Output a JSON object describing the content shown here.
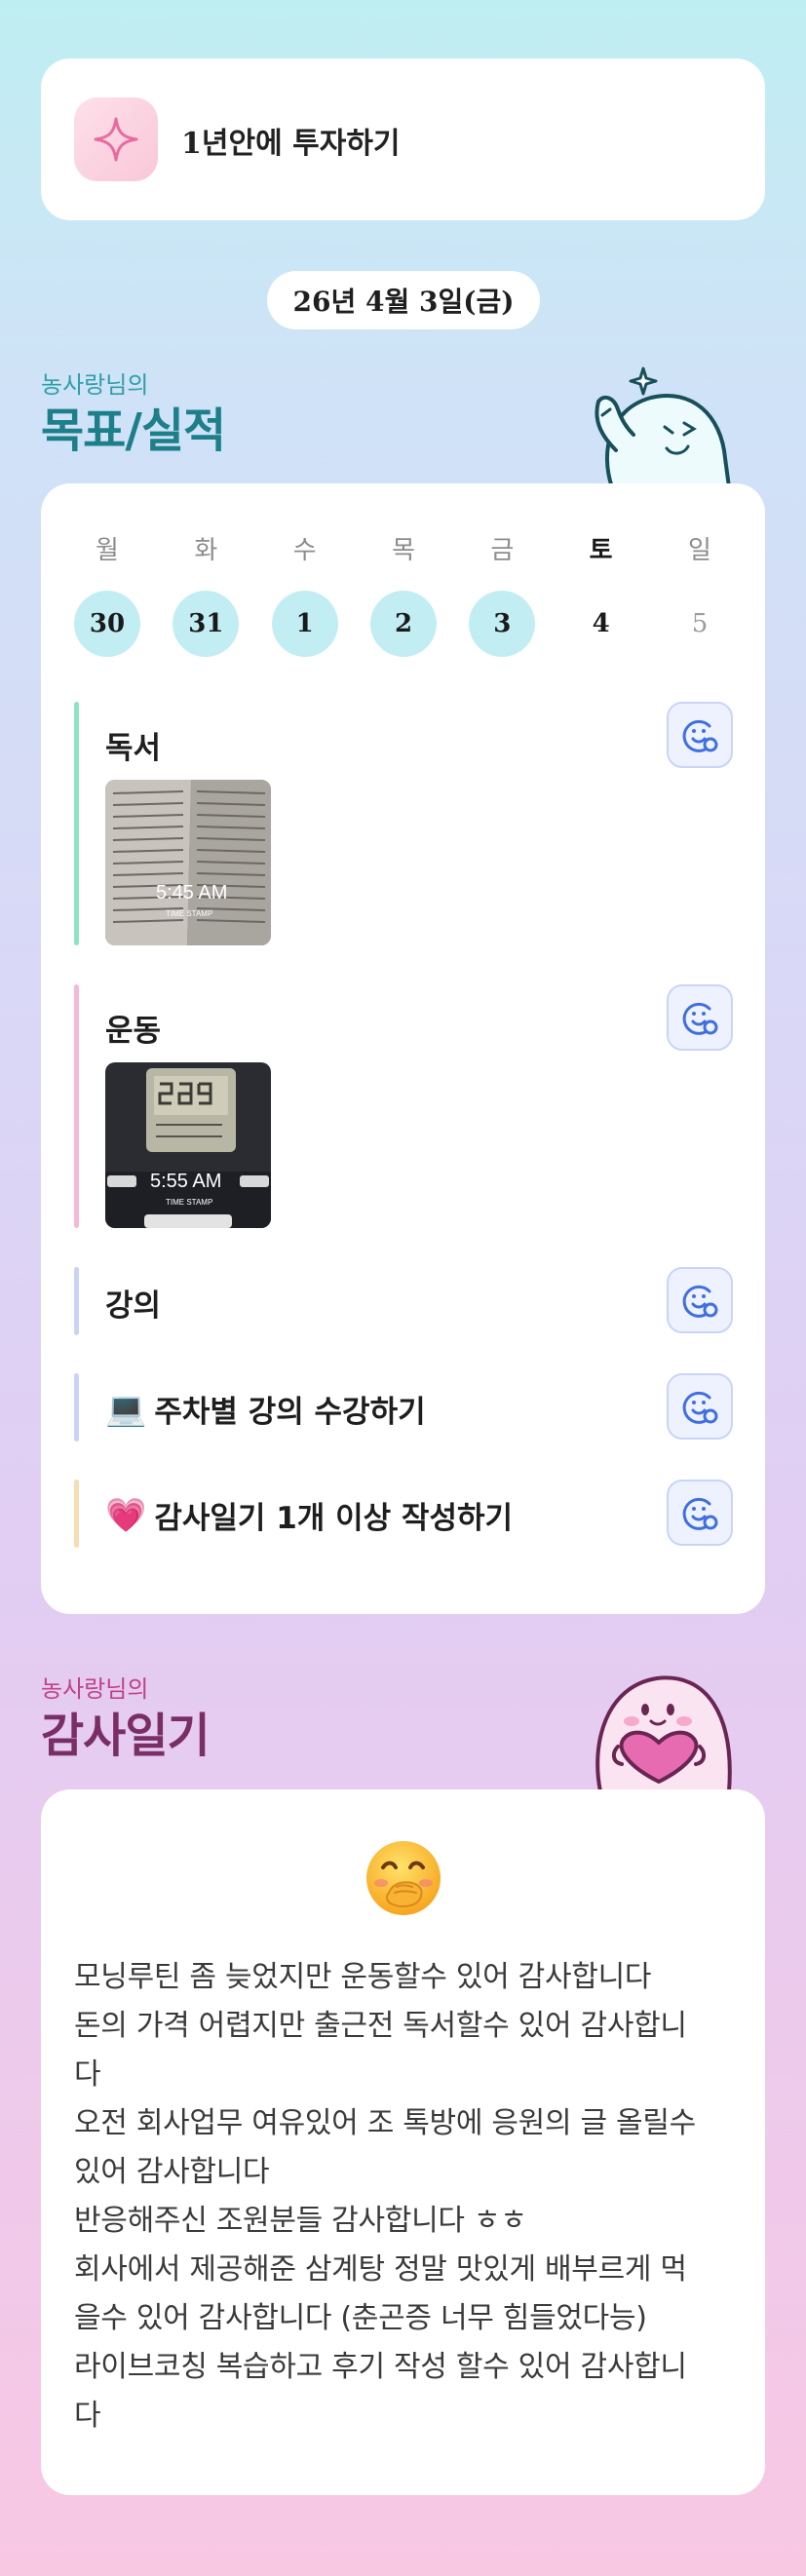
{
  "goal": {
    "text": "1년안에 투자하기",
    "icon": "sparkle-icon"
  },
  "date": "26년 4월 3일(금)",
  "performance": {
    "subtitle": "농사랑님의",
    "title": "목표/실적"
  },
  "week": {
    "days": [
      {
        "name": "월",
        "num": "30",
        "done": true
      },
      {
        "name": "화",
        "num": "31",
        "done": true
      },
      {
        "name": "수",
        "num": "1",
        "done": true
      },
      {
        "name": "목",
        "num": "2",
        "done": true
      },
      {
        "name": "금",
        "num": "3",
        "done": true
      },
      {
        "name": "토",
        "num": "4",
        "done": false,
        "today": true
      },
      {
        "name": "일",
        "num": "5",
        "done": false,
        "future": true
      }
    ]
  },
  "tasks": [
    {
      "label": "독서",
      "bar_color": "#8ee3c6",
      "has_photo": true,
      "photo_time": "5:45 AM",
      "photo_stamp": "TIME STAMP"
    },
    {
      "label": "운동",
      "bar_color": "#f6b8d6",
      "has_photo": true,
      "photo_time": "5:55 AM",
      "photo_stamp": "TIME STAMP"
    },
    {
      "label": "강의",
      "bar_color": "#c9d3f6",
      "has_photo": false
    },
    {
      "label": "주차별 강의 수강하기",
      "emoji": "💻",
      "bar_color": "#c9d3f6",
      "has_photo": false
    },
    {
      "label": "감사일기 1개 이상 작성하기",
      "emoji": "💗",
      "bar_color": "#f8dcb2",
      "has_photo": false
    }
  ],
  "gratitude": {
    "subtitle": "농사랑님의",
    "title": "감사일기",
    "emoji": "🤭",
    "lines": [
      "모닝루틴 좀 늦었지만 운동할수 있어 감사합니다",
      "돈의 가격 어렵지만 출근전 독서할수 있어 감사합니",
      "다",
      "오전 회사업무 여유있어 조 톡방에 응원의 글 올릴수",
      "있어 감사합니다",
      "반응해주신 조원분들 감사합니다 ㅎㅎ",
      "회사에서 제공해준 삼계탕 정말 맛있게 배부르게 먹",
      "을수 있어 감사합니다 (춘곤증 너무 힘들었다능)",
      "라이브코칭 복습하고 후기 작성 할수 있어 감사합니",
      "다"
    ]
  },
  "colors": {
    "teal": "#1d7f8a",
    "plum": "#7a2e66",
    "done_day": "#c2eef3",
    "react_btn": "#eef2ff"
  }
}
